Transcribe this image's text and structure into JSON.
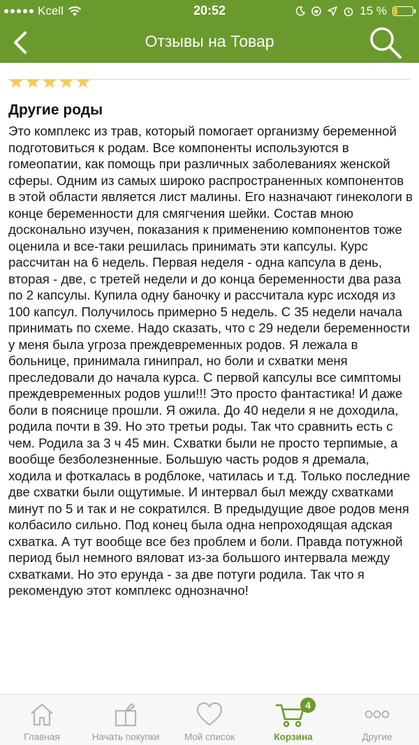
{
  "status_bar": {
    "carrier": "Kcell",
    "time": "20:52",
    "battery": "15 %"
  },
  "nav": {
    "title": "Отзывы на Товар"
  },
  "review": {
    "rating": 5,
    "title": "Другие роды",
    "text": "Это комплекс из трав, который помогает организму беременной подготовиться к родам.  Все компоненты используются в гомеопатии, как помощь  при различных заболеваниях женской сферы. Одним из самых широко распространенных компонентов в этой области является лист малины. Его назначают гинекологи в конце беременности для смягчения шейки. Состав мною досконально изучен, показания к применению компонентов тоже оценила и все-таки решилась принимать эти капсулы. Курс рассчитан на 6 недель. Первая неделя - одна капсула в день, вторая - две, с третей недели и до конца беременности два раза по 2 капсулы. Купила одну баночку и рассчитала курс исходя из 100 капсул. Получилось примерно 5 недель. С 35 недели начала принимать по схеме. Надо сказать, что с 29 недели беременности у меня была угроза преждевременных родов. Я лежала в больнице, принимала гинипрал, но боли и схватки меня преследовали до начала курса. С первой капсулы все симптомы преждевременных родов ушли!!! Это просто фантастика! И даже боли в пояснице прошли. Я ожила. До 40 недели я не доходила, родила почти в 39. Но это третьи роды. Так что сравнить есть с чем. Родила за 3 ч 45 мин. Схватки были не просто терпимые, а вообще безболезненные. Большую часть родов я дремала, ходила и фоткалась в родблоке, чатилась и т.д. Только последние две схватки были ощутимые. И интервал был между схватками минут по 5 и так и не сократился. В предыдущие двое родов меня колбасило сильно. Под конец была одна непроходящая адская схватка. А тут вообще все без проблем и боли. Правда потужной период был немного вяловат из-за большого интервала между схватками. Но это ерунда - за две потуги родила. Так что я рекомендую этот комплекс однозначно!"
  },
  "tabs": [
    {
      "label": "Главная",
      "icon": "home-icon"
    },
    {
      "label": "Начать покупки",
      "icon": "gift-icon"
    },
    {
      "label": "Мой список",
      "icon": "heart-icon"
    },
    {
      "label": "Корзина",
      "icon": "cart-icon",
      "badge": "4",
      "active": true
    },
    {
      "label": "Другие",
      "icon": "more-icon"
    }
  ],
  "colors": {
    "brand_green": "#6a9a2e",
    "star": "#f2cc5a",
    "tab_inactive": "#999999"
  }
}
